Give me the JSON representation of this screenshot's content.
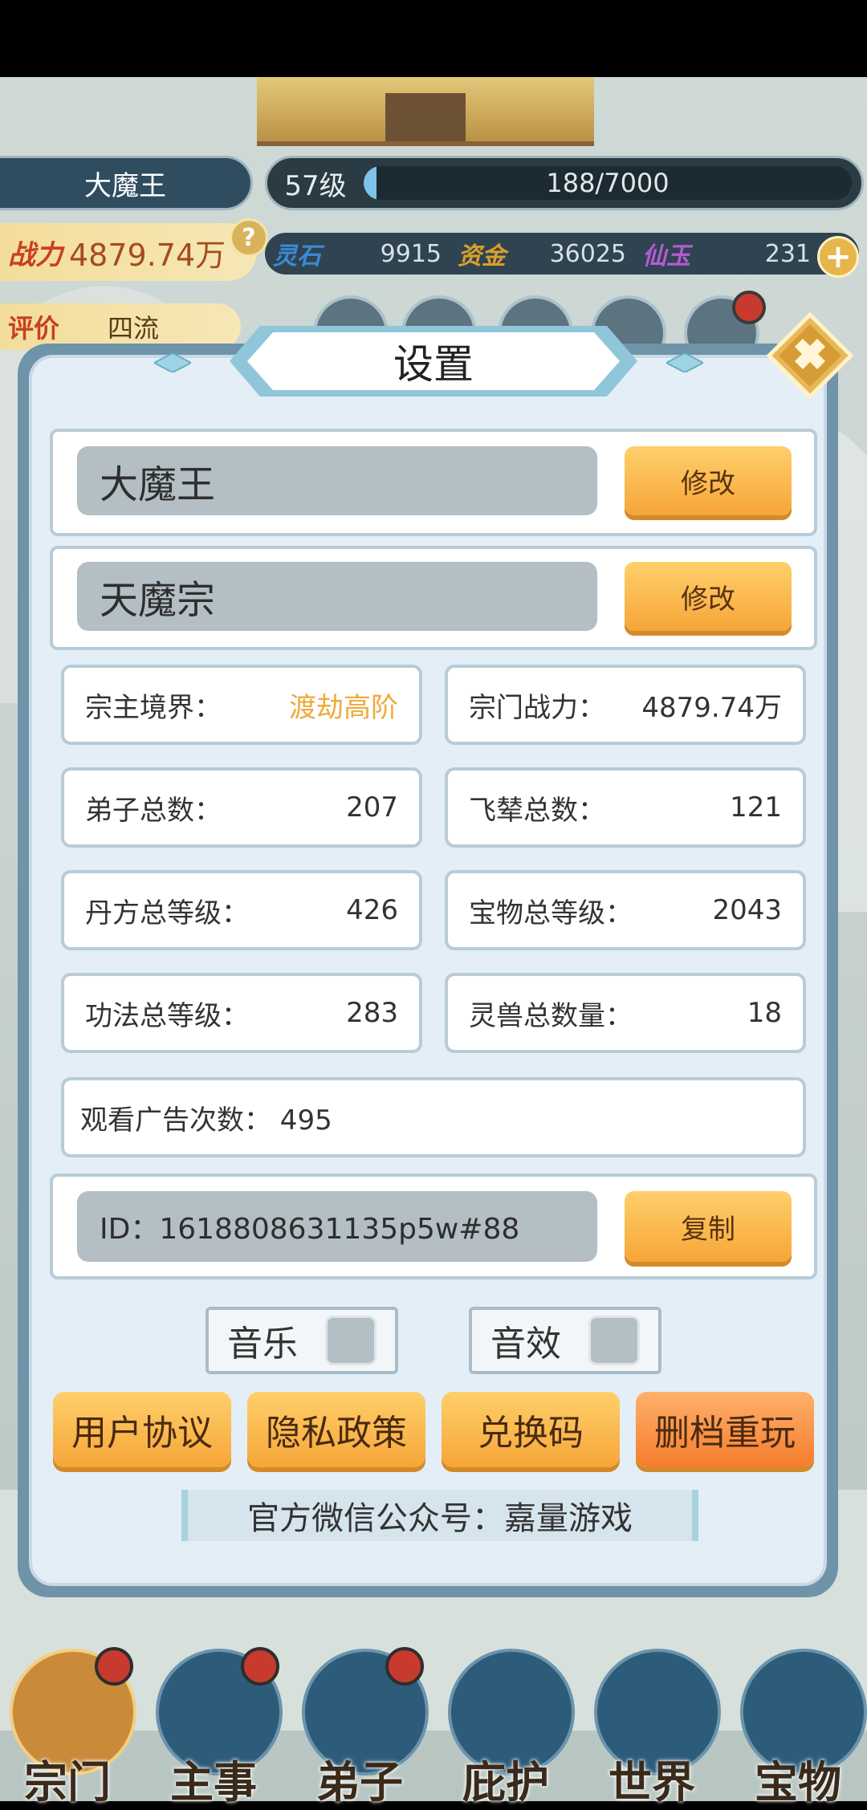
{
  "hud": {
    "player_name": "大魔王",
    "level": "57级",
    "exp_text": "188/7000",
    "exp_progress": 0.027,
    "power_label": "战力",
    "power_value": "4879.74万",
    "resources": [
      {
        "label": "灵石",
        "value": "9915",
        "color": "#3a8ad6"
      },
      {
        "label": "资金",
        "value": "36025",
        "color": "#d9a02a"
      },
      {
        "label": "仙玉",
        "value": "231",
        "color": "#b45ad6"
      }
    ],
    "rating_label": "评价",
    "rating_value": "四流"
  },
  "dialog": {
    "title": "设置",
    "player_name": "大魔王",
    "sect_name": "天魔宗",
    "modify_label": "修改",
    "stats": [
      {
        "label": "宗主境界：",
        "value": "渡劫高阶",
        "highlight": true
      },
      {
        "label": "宗门战力：",
        "value": "4879.74万"
      },
      {
        "label": "弟子总数：",
        "value": "207"
      },
      {
        "label": "飞辇总数：",
        "value": "121"
      },
      {
        "label": "丹方总等级：",
        "value": "426"
      },
      {
        "label": "宝物总等级：",
        "value": "2043"
      },
      {
        "label": "功法总等级：",
        "value": "283"
      },
      {
        "label": "灵兽总数量：",
        "value": "18"
      }
    ],
    "ad_views": "观看广告次数：  495",
    "id_text": "ID：1618808631135p5w#88",
    "copy_label": "复制",
    "music_label": "音乐",
    "sfx_label": "音效",
    "buttons": {
      "user_agreement": "用户协议",
      "privacy_policy": "隐私政策",
      "redeem_code": "兑换码",
      "delete_restart": "删档重玩"
    },
    "wechat": "官方微信公众号：嘉量游戏"
  },
  "nav": [
    {
      "label": "宗门",
      "has_badge": true
    },
    {
      "label": "主事",
      "has_badge": true
    },
    {
      "label": "弟子",
      "has_badge": true
    },
    {
      "label": "庇护",
      "has_badge": false
    },
    {
      "label": "世界",
      "has_badge": false
    },
    {
      "label": "宝物",
      "has_badge": false
    }
  ]
}
